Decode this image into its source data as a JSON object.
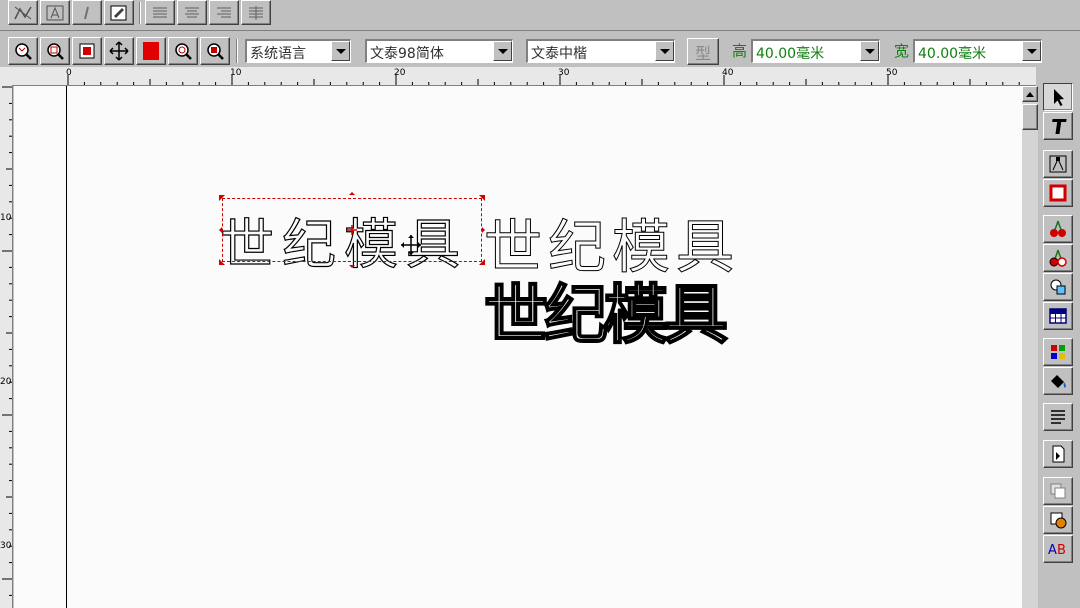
{
  "toolbar_top": {
    "icons": [
      "graph-icon",
      "text-frame-icon",
      "italic-icon",
      "edit-icon",
      "align-left-icon",
      "align-center-icon",
      "align-right-icon",
      "align-justify-icon"
    ]
  },
  "toolbar_main": {
    "zoom_icons": [
      "zoom-fit-icon",
      "zoom-in-icon",
      "zoom-select-icon",
      "pan-icon",
      "fill-color-icon",
      "zoom-out-icon",
      "zoom-page-icon"
    ],
    "language_select": "系统语言",
    "font_select": "文泰98简体",
    "style_select": "文泰中楷",
    "type_button": "型",
    "height_label": "高",
    "height_value": "40.00毫米",
    "width_label": "宽",
    "width_value": "40.00毫米"
  },
  "ruler": {
    "h_labels": [
      "0",
      "10",
      "20",
      "30",
      "40",
      "50"
    ],
    "v_labels": [
      "10",
      "20",
      "30"
    ]
  },
  "canvas": {
    "text_selected": "世纪模具",
    "text_outline_thin": "世纪模具",
    "text_outline_bold": "世纪模具"
  },
  "right_toolbar": {
    "icons": [
      "select-arrow-icon",
      "text-tool-icon",
      "node-edit-icon",
      "rectangle-icon",
      "cherry-icon",
      "cherry-outline-icon",
      "shapes-icon",
      "table-icon",
      "color-grid-icon",
      "fill-bucket-icon",
      "paragraph-icon",
      "page-flip-icon",
      "layers-icon",
      "gradient-icon",
      "ab-text-icon"
    ]
  },
  "colors": {
    "accent_red": "#d00000",
    "label_green": "#108010",
    "canvas_bg": "#fbfbfb",
    "toolbar_bg": "#c0c0c0"
  }
}
